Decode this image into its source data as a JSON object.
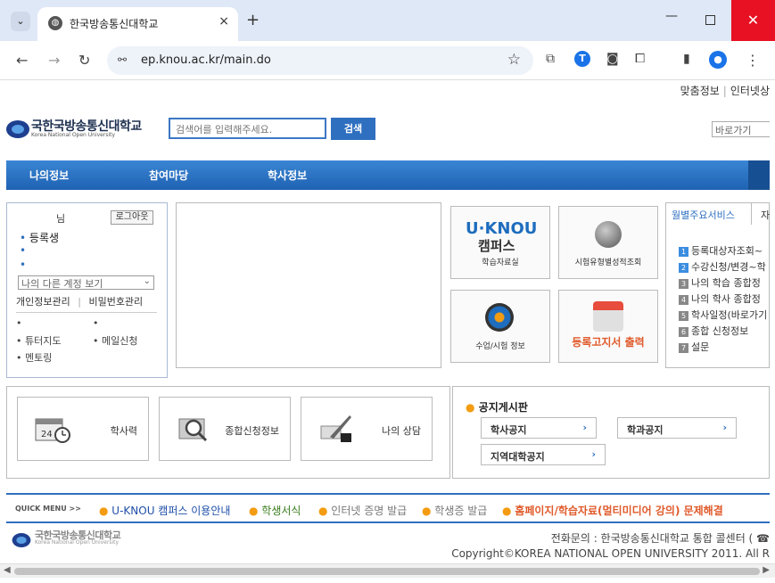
{
  "browser": {
    "tab_title": "한국방송통신대학교",
    "url": "ep.knou.ac.kr/main.do",
    "new_tab": "+",
    "close_tab": "×",
    "minimize": "—",
    "close_window": "✕"
  },
  "header": {
    "util_links": [
      "맞춤정보",
      "인터넷상"
    ],
    "logo_text": "국한국방송통신대학교",
    "logo_sub": "Korea National Open University",
    "search_placeholder": "검색어를 입력해주세요.",
    "search_button": "검색",
    "goto_select": "바로가기"
  },
  "gnb": {
    "items": [
      "나의정보",
      "참여마당",
      "학사정보"
    ]
  },
  "login": {
    "nim": "님",
    "logout": "로그아웃",
    "status": "등록생",
    "account_select": "나의 다른 계정 보기",
    "link_profile": "개인정보관리",
    "link_password": "비밀번호관리",
    "link_sep": "|",
    "tutor_map": "튜터지도",
    "mail_request": "메일신청",
    "mentoring": "멘토링"
  },
  "tiles": {
    "uknou_logo": "U·KNOU",
    "uknou_sub": "캠퍼스",
    "uknou_label": "학습자료실",
    "exam_label": "시험유형별성적조회",
    "class_label": "수업/시험 정보",
    "print_label": "등록고지서 출력"
  },
  "services": {
    "tab_active": "월별주요서비스",
    "tab_2": "자",
    "items": [
      {
        "num": "1",
        "label": "등록대상자조회~"
      },
      {
        "num": "2",
        "label": "수강신청/변경~학"
      },
      {
        "num": "3",
        "label": "나의 학습 종합정"
      },
      {
        "num": "4",
        "label": "나의 학사 종합정"
      },
      {
        "num": "5",
        "label": "학사일정(바로가기"
      },
      {
        "num": "6",
        "label": "종합 신청정보"
      },
      {
        "num": "7",
        "label": "설문"
      }
    ]
  },
  "quick_boxes": {
    "calendar": "학사력",
    "search_info": "종합신청정보",
    "consult": "나의 상담"
  },
  "board": {
    "title": "공지게시판",
    "academic": "학사공지",
    "department": "학과공지",
    "regional": "지역대학공지"
  },
  "quick_menu": {
    "title": "QUICK MENU >>",
    "items": [
      {
        "label": "U-KNOU 캠퍼스 이용안내",
        "color": "#1e4fa8"
      },
      {
        "label": "학생서식",
        "color": "#3a7d1e"
      },
      {
        "label": "인터넷 증명 발급",
        "color": "#777777"
      },
      {
        "label": "학생증 발급",
        "color": "#777777"
      },
      {
        "label": "홈페이지/학습자료(멀티미디어 강의) 문제해결",
        "color": "#e05a2b"
      }
    ]
  },
  "footer": {
    "logo_text": "국한국방송통신대학교",
    "logo_sub": "Korea National Open University",
    "contact": "전화문의 : 한국방송통신대학교 통합 콜센터 ( ☎",
    "copyright": "Copyright©KOREA NATIONAL OPEN UNIVERSITY 2011. All R"
  }
}
